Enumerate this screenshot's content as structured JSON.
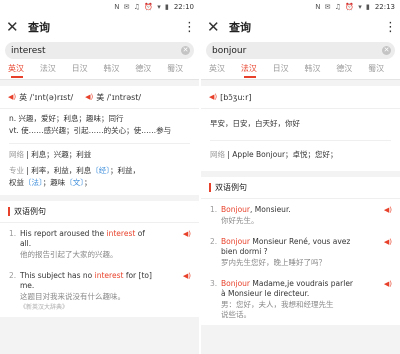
{
  "left": {
    "time": "22:10",
    "status_icons": "N ✉ ♫ ⏰ ▾ ▮",
    "title": "查询",
    "query": "interest",
    "tabs": [
      "英汉",
      "法汉",
      "日汉",
      "韩汉",
      "德汉",
      "蜀汉"
    ],
    "phonetic_uk": "英 /ˈɪnt(ə)rɪst/",
    "phonetic_us": "美 /ˈɪntrəst/",
    "definitions": [
      "n. 兴趣，爱好；利息；趣味；同行",
      "vt. 使……感兴趣；引起……的关心；使……参与"
    ],
    "web_label": "网络",
    "web_value": "利息；兴趣；利益",
    "pro_label": "专业",
    "pro_line1_a": "利率，利益，利息",
    "pro_tag1": "〔经〕",
    "pro_line1_b": "；利益，",
    "pro_line2_a": "权益",
    "pro_tag2": "〔法〕",
    "pro_line2_b": "；趣味",
    "pro_tag3": "〔文〕",
    "pro_line2_c": "；",
    "examples_title": "双语例句",
    "examples": [
      {
        "num": "1.",
        "pre": "His report aroused the ",
        "hl": "interest",
        "post": " of",
        "cont": "all.",
        "zh": "他的报告引起了大家的兴趣。",
        "src": ""
      },
      {
        "num": "2.",
        "pre": "This subject has no ",
        "hl": "interest",
        "post": " for [to]",
        "cont": "me.",
        "zh": "这题目对我来说没有什么趣味。",
        "src": "《新英汉大辞典》"
      }
    ]
  },
  "right": {
    "time": "22:13",
    "status_icons": "N ✉ ♫ ⏰ ▾ ▮",
    "title": "查询",
    "query": "bonjour",
    "tabs": [
      "英汉",
      "法汉",
      "日汉",
      "韩汉",
      "德汉",
      "蜀汉"
    ],
    "phonetic": "[bɔ̃ʒuːr]",
    "definition": "早安，日安，白天好，你好",
    "web_label": "网络",
    "web_value": "Apple Bonjour；卓悦；您好；",
    "examples_title": "双语例句",
    "examples": [
      {
        "num": "1.",
        "hl": "Bonjour",
        "post": ", Monsieur.",
        "cont": "",
        "zh": "你好先生。",
        "zh2": ""
      },
      {
        "num": "2.",
        "hl": "Bonjour",
        "post": " Monsieur René, vous avez",
        "cont": "bien dormi ?",
        "zh": "罗内先生您好，晚上睡好了吗？",
        "zh2": ""
      },
      {
        "num": "3.",
        "hl": "Bonjour",
        "post": " Madame,je voudrais parler",
        "cont": "à Monsieur le directeur.",
        "zh": "男：您好，夫人，我想和经理先生",
        "zh2": "说些话。"
      }
    ]
  },
  "colors": {
    "accent": "#e8412b",
    "link": "#3f8fdc",
    "background": "#f3f3f3"
  }
}
